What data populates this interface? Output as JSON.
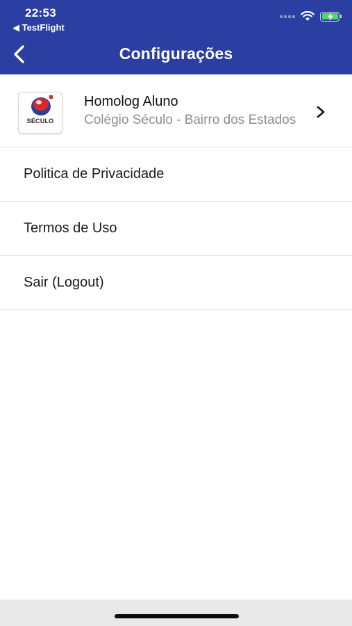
{
  "status_bar": {
    "time": "22:53",
    "back_app": "◀ TestFlight",
    "battery_color": "#4cd964"
  },
  "header": {
    "title": "Configurações",
    "background_color": "#2b3ea2",
    "back_icon": "chevron-left-icon"
  },
  "account": {
    "name": "Homolog Aluno",
    "school": "Colégio Século - Bairro dos Estados",
    "logo_text": "SÉCULO",
    "chevron_icon": "chevron-right-icon"
  },
  "menu": {
    "items": [
      {
        "label": "Politica de Privacidade"
      },
      {
        "label": "Termos de Uso"
      },
      {
        "label": "Sair (Logout)"
      }
    ]
  }
}
